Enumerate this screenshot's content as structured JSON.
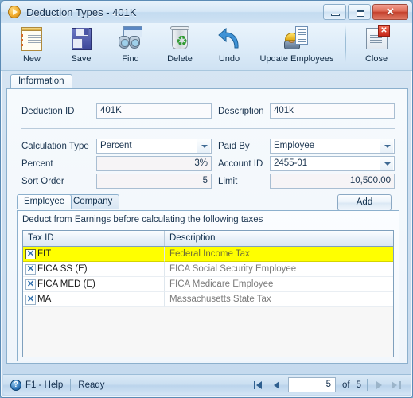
{
  "window": {
    "title": "Deduction Types - 401K",
    "title_icon": "play-circle-icon",
    "controls": {
      "minimize": "minimize-button",
      "maximize": "maximize-button",
      "close": "close-button",
      "close_glyph": "✕"
    }
  },
  "toolbar": {
    "buttons": [
      {
        "label": "New",
        "icon": "new-document-icon"
      },
      {
        "label": "Save",
        "icon": "floppy-disk-save-icon"
      },
      {
        "label": "Find",
        "icon": "binoculars-find-icon"
      },
      {
        "label": "Delete",
        "icon": "recycle-bin-delete-icon"
      },
      {
        "label": "Undo",
        "icon": "undo-arrow-icon"
      },
      {
        "label": "Update Employees",
        "icon": "update-employees-icon"
      },
      {
        "label": "Close",
        "icon": "close-window-icon"
      }
    ]
  },
  "main_tab": {
    "label": "Information"
  },
  "form": {
    "deduction_id": {
      "label": "Deduction ID",
      "value": "401K"
    },
    "description": {
      "label": "Description",
      "value": "401k"
    },
    "calculation_type": {
      "label": "Calculation Type",
      "value": "Percent"
    },
    "paid_by": {
      "label": "Paid By",
      "value": "Employee"
    },
    "percent": {
      "label": "Percent",
      "value": "3%"
    },
    "account_id": {
      "label": "Account ID",
      "value": "2455-01"
    },
    "sort_order": {
      "label": "Sort Order",
      "value": "5"
    },
    "limit": {
      "label": "Limit",
      "value": "10,500.00"
    }
  },
  "sub_tabs": {
    "employee": "Employee",
    "company": "Company",
    "add_button": "Add"
  },
  "grid": {
    "hint": "Deduct from Earnings before calculating the following taxes",
    "columns": [
      "Tax ID",
      "Description"
    ],
    "delete_glyph": "✕",
    "rows": [
      {
        "tax_id": "FIT",
        "description": "Federal Income Tax",
        "selected": true
      },
      {
        "tax_id": "FICA SS (E)",
        "description": "FICA Social Security Employee",
        "selected": false
      },
      {
        "tax_id": "FICA MED (E)",
        "description": "FICA Medicare Employee",
        "selected": false
      },
      {
        "tax_id": "MA",
        "description": "Massachusetts State Tax",
        "selected": false
      }
    ]
  },
  "statusbar": {
    "help_glyph": "?",
    "help_text": "F1 - Help",
    "status_text": "Ready",
    "record_current": "5",
    "record_of": "of",
    "record_total": "5",
    "nav": {
      "first": "first-record-button",
      "prev": "previous-record-button",
      "next": "next-record-button",
      "last": "last-record-button"
    }
  },
  "colors": {
    "accent": "#2e5f8f",
    "selection_highlight": "#ffff00",
    "window_border": "#5b8bb5",
    "close_button": "#c4402c"
  }
}
